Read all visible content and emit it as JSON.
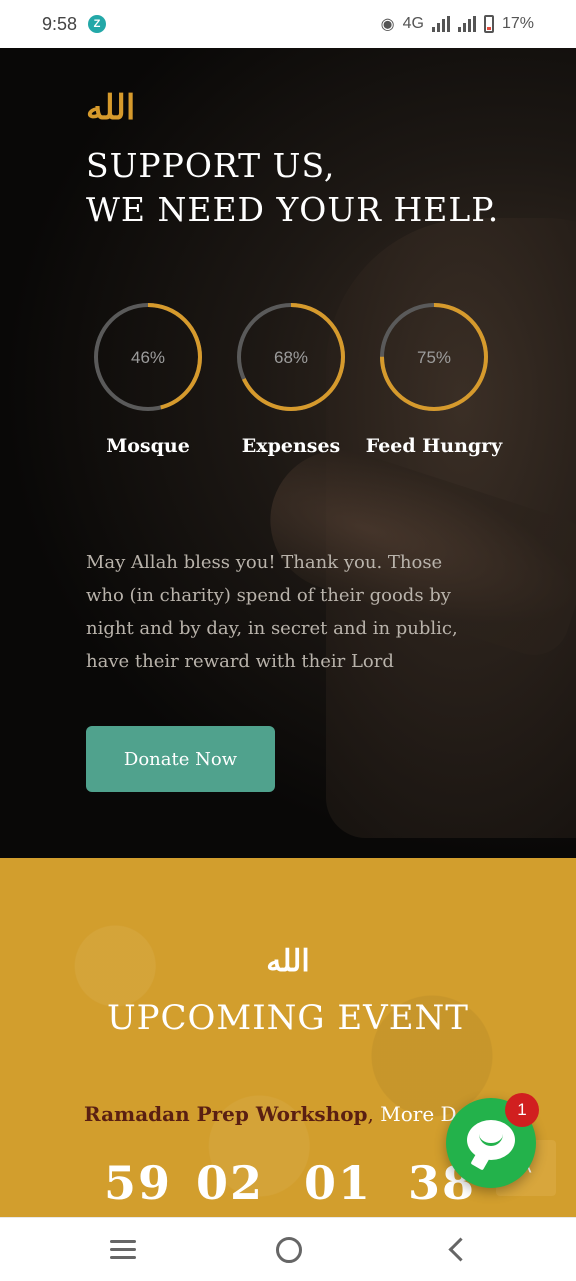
{
  "status_bar": {
    "time": "9:58",
    "app_indicator": "Z",
    "network": "4G",
    "battery": "17%"
  },
  "hero": {
    "logo": "الله",
    "title_line1": "SUPPORT US,",
    "title_line2": "WE NEED YOUR HELP.",
    "progress": [
      {
        "label": "Mosque",
        "percent_text": "46%",
        "value": 46
      },
      {
        "label": "Expenses",
        "percent_text": "68%",
        "value": 68
      },
      {
        "label": "Feed Hungry",
        "percent_text": "75%",
        "value": 75
      }
    ],
    "quote": "May Allah bless you! Thank you. Those who (in charity) spend of their goods by night and by day, in secret and in public, have their reward with their Lord",
    "donate_label": "Donate Now"
  },
  "event": {
    "logo": "الله",
    "title": "UPCOMING EVENT",
    "event_name": "Ramadan Prep Workshop",
    "separator": ",",
    "more_link": " More Det",
    "countdown": [
      "59",
      "02",
      "01",
      "38"
    ]
  },
  "chat": {
    "badge_count": "1"
  },
  "colors": {
    "accent_gold": "#d69a2c",
    "ring_track": "#5a5a5a",
    "donate_button": "#50a28d",
    "event_bg": "#d29e2d",
    "event_name": "#5a1f12",
    "chat_green": "#23b24b",
    "badge_red": "#d11f1f"
  },
  "icons": [
    "radar-icon",
    "signal-icon",
    "battery-icon",
    "chat-icon",
    "chevron-up-icon",
    "menu-icon",
    "home-icon",
    "back-icon"
  ]
}
